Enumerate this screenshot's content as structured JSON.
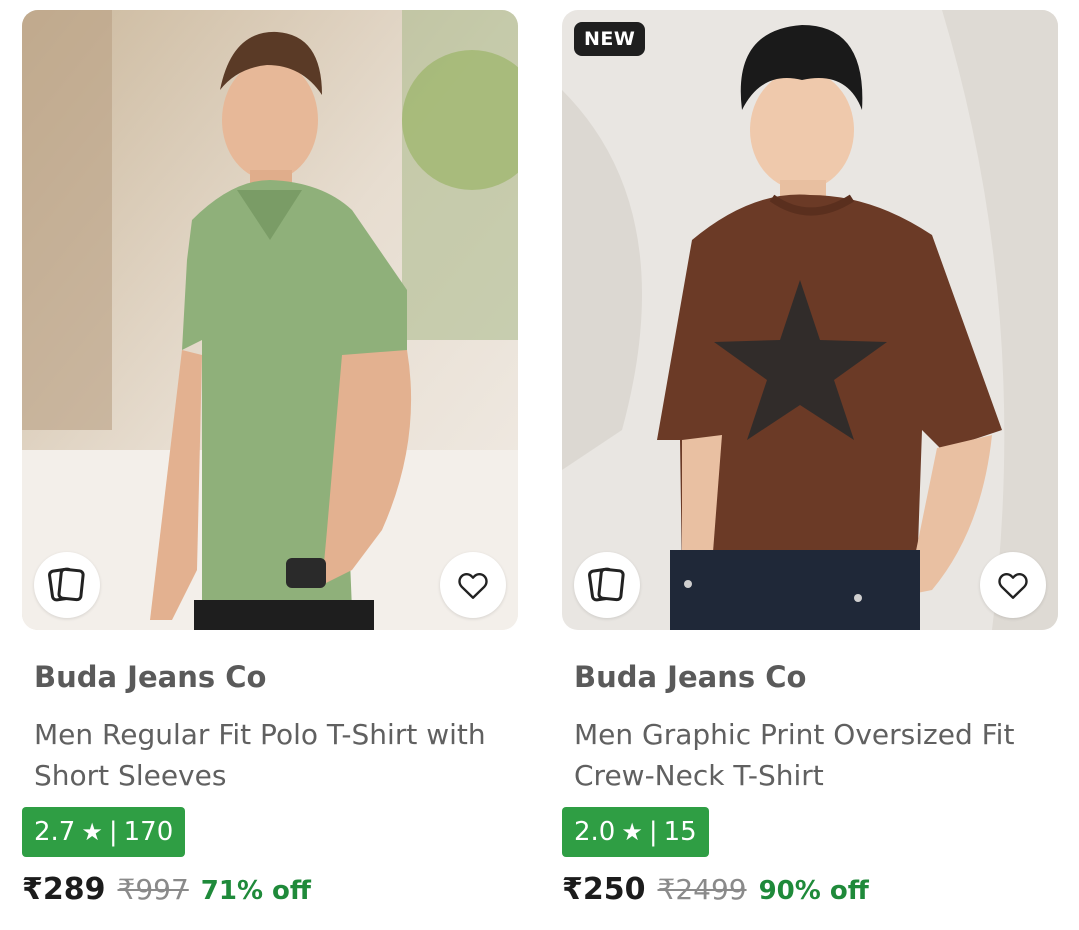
{
  "products": [
    {
      "brand": "Buda Jeans Co",
      "title": "Men Regular Fit Polo T-Shirt with Short Sleeves",
      "rating": "2.7",
      "reviews": "170",
      "price": "₹289",
      "mrp": "₹997",
      "discount": "71% off",
      "new_badge": "",
      "shirt_color": "#8fb07a"
    },
    {
      "brand": "Buda Jeans Co",
      "title": "Men Graphic Print Oversized Fit Crew-Neck T-Shirt",
      "rating": "2.0",
      "reviews": "15",
      "price": "₹250",
      "mrp": "₹2499",
      "discount": "90% off",
      "new_badge": "NEW",
      "shirt_color": "#6b3a26"
    }
  ],
  "icons": {
    "similar": "cards-stack-icon",
    "wishlist": "heart-outline-icon",
    "rating": "star-icon"
  },
  "colors": {
    "rating_bg": "#2f9e44",
    "discount": "#1f8a3a"
  }
}
